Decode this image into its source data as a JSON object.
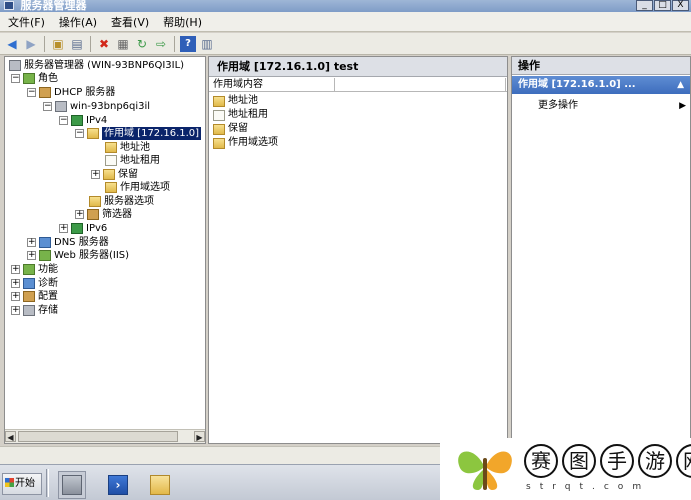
{
  "window": {
    "title": "服务器管理器",
    "controls": {
      "minimize": "_",
      "maximize": "□",
      "close": "X"
    }
  },
  "menu": [
    "文件(F)",
    "操作(A)",
    "查看(V)",
    "帮助(H)"
  ],
  "toolbar_icons": [
    "back-icon",
    "forward-icon",
    "up-icon",
    "show-hide-tree-icon",
    "delete-icon",
    "properties-icon",
    "refresh-icon",
    "export-icon",
    "help-icon",
    "show-hide-action-icon"
  ],
  "tree": {
    "root": "服务器管理器 (WIN-93BNP6QI3IL)",
    "roles": "角色",
    "dhcp": "DHCP 服务器",
    "host": "win-93bnp6qi3il",
    "ipv4": "IPv4",
    "scope": "作用域 [172.16.1.0]",
    "addr_pool": "地址池",
    "addr_lease": "地址租用",
    "reservations": "保留",
    "scope_options": "作用域选项",
    "server_options": "服务器选项",
    "filters": "筛选器",
    "ipv6": "IPv6",
    "dns": "DNS 服务器",
    "web": "Web 服务器(IIS)",
    "features": "功能",
    "diagnostics": "诊断",
    "configuration": "配置",
    "storage": "存储"
  },
  "center": {
    "header": "作用域 [172.16.1.0] test",
    "column": "作用域内容",
    "items": [
      "地址池",
      "地址租用",
      "保留",
      "作用域选项"
    ]
  },
  "actions": {
    "header": "操作",
    "section": "作用域 [172.16.1.0] ...",
    "more": "更多操作"
  },
  "taskbar": {
    "start": "开始"
  },
  "watermark": {
    "chars": [
      "赛",
      "图",
      "手",
      "游",
      "网"
    ],
    "sub": "strqt.com"
  }
}
